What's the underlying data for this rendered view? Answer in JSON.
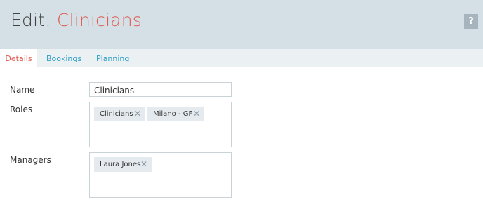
{
  "header": {
    "title_prefix": "Edit:",
    "title_entity": "Clinicians",
    "help_label": "?"
  },
  "tabs": [
    {
      "label": "Details",
      "active": true
    },
    {
      "label": "Bookings",
      "active": false
    },
    {
      "label": "Planning",
      "active": false
    }
  ],
  "form": {
    "name_label": "Name",
    "name_value": "Clinicians",
    "roles_label": "Roles",
    "roles": [
      {
        "label": "Clinicians",
        "remove_icon": "close-icon"
      },
      {
        "label": "Milano - GF",
        "remove_icon": "close-icon"
      }
    ],
    "managers_label": "Managers",
    "managers": [
      {
        "label": "Laura Jones",
        "remove_icon": "close-icon"
      }
    ]
  },
  "colors": {
    "accent": "#e05a4f",
    "link": "#2c9ec4",
    "header_bg": "#d5e0e6",
    "tabbar_bg": "#ebf0f3",
    "chip_bg": "#e4eaee"
  }
}
